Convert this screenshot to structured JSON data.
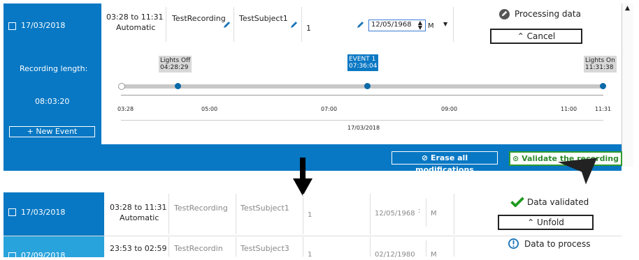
{
  "top_row": {
    "date": "17/03/2018",
    "time_range": "03:28 to 11:31",
    "mode": "Automatic",
    "recording": "TestRecording",
    "subject": "TestSubject1",
    "count": "1",
    "birthdate": "12/05/1968",
    "sex": "M",
    "status": "Processing data",
    "cancel_label": "Cancel"
  },
  "side_panel": {
    "length_label": "Recording length:",
    "length_value": "08:03:20",
    "new_event_label": "+ New Event"
  },
  "timeline": {
    "events": [
      {
        "title": "Lights Off",
        "time": "04:28:29"
      },
      {
        "title": "EVENT 1",
        "time": "07:36:04"
      },
      {
        "title": "Lights On",
        "time": "11:31:38"
      }
    ],
    "ticks": [
      "03:28",
      "05:00",
      "07:00",
      "09:00",
      "11:00",
      "11:31"
    ],
    "date": "17/03/2018"
  },
  "actions": {
    "erase_label": "Erase all modifications",
    "validate_label": "Validate the recording"
  },
  "bottom_rows": [
    {
      "date": "17/03/2018",
      "time_range": "03:28 to 11:31",
      "mode": "Automatic",
      "recording": "TestRecording",
      "subject": "TestSubject1",
      "count": "1",
      "birthdate": "12/05/1968",
      "sex": "M",
      "status": "Data validated",
      "unfold_label": "Unfold"
    },
    {
      "date": "07/09/2018",
      "time_range": "23:53 to 02:59",
      "recording": "TestRecordin",
      "subject": "TestSubject3",
      "count": "1",
      "birthdate": "02/12/1980",
      "sex": "M",
      "status": "Data to process"
    }
  ],
  "colors": {
    "accent": "#0878c4",
    "validate": "#2e9a2e",
    "row2": "#29a3dc"
  }
}
